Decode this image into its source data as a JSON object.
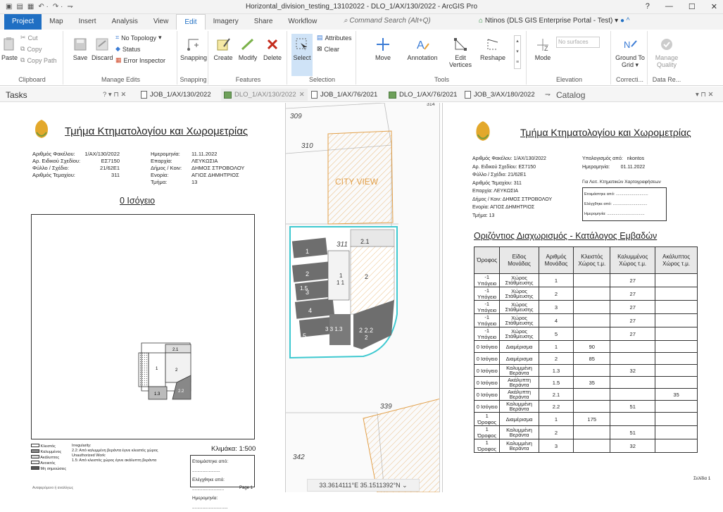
{
  "window": {
    "title": "Horizontal_division_testing_13102022 - DLO_1/AX/130/2022 - ArcGIS Pro",
    "help": "?",
    "minimize": "—",
    "maximize": "☐",
    "close": "✕"
  },
  "ribbon_tabs": [
    "Project",
    "Map",
    "Insert",
    "Analysis",
    "View",
    "Edit",
    "Imagery",
    "Share",
    "Workflow"
  ],
  "command_search_placeholder": "Command Search (Alt+Q)",
  "portal": "Ntinos (DLS GIS Enterprise Portal - Test) ▾",
  "ribbon": {
    "clipboard": {
      "label": "Clipboard",
      "paste": "Paste",
      "cut": "Cut",
      "copy": "Copy",
      "copy_path": "Copy Path"
    },
    "manage_edits": {
      "label": "Manage Edits",
      "save": "Save",
      "discard": "Discard",
      "no_topology": "No Topology",
      "status": "Status",
      "error_inspector": "Error Inspector"
    },
    "snapping": {
      "label": "Snapping",
      "snapping": "Snapping"
    },
    "features": {
      "label": "Features",
      "create": "Create",
      "modify": "Modify",
      "delete": "Delete"
    },
    "selection": {
      "label": "Selection",
      "select": "Select",
      "attributes": "Attributes",
      "clear": "Clear"
    },
    "tools": {
      "label": "Tools",
      "move": "Move",
      "annotation": "Annotation",
      "edit_vertices": "Edit Vertices",
      "reshape": "Reshape"
    },
    "elevation": {
      "label": "Elevation",
      "mode": "Mode",
      "no_surfaces": "No surfaces"
    },
    "correction": {
      "label": "Correcti...",
      "ground_to_grid": "Ground To Grid ▾"
    },
    "data_review": {
      "label": "Data Re...",
      "manage_quality": "Manage Quality"
    }
  },
  "panes": {
    "tasks_title": "Tasks",
    "tasks_controls": "? ▾ ⊓ ✕",
    "catalog_title": "Catalog",
    "catalog_controls": "▾ ⊓ ✕",
    "doc_tabs": [
      {
        "label": "JOB_1/AX/130/2022",
        "type": "layout",
        "active": false
      },
      {
        "label": "DLO_1/AX/130/2022",
        "type": "map",
        "active": true
      },
      {
        "label": "JOB_1/AX/76/2021",
        "type": "layout",
        "active": false
      },
      {
        "label": "DLO_1/AX/76/2021",
        "type": "map",
        "active": false
      },
      {
        "label": "JOB_3/AX/180/2022",
        "type": "layout",
        "active": false
      }
    ],
    "overflow": "⇁"
  },
  "left_sheet": {
    "title": "Τμήμα Κτηματολογίου και Χωρομετρίας",
    "fields_left": [
      [
        "Αριθμός Φακέλου:",
        "1/AX/130/2022"
      ],
      [
        "Αρ. Ειδικού Σχεδίου:",
        "ΕΣ7150"
      ],
      [
        "Φύλλο / Σχέδιο:",
        "21/62E1"
      ],
      [
        "Αριθμός Τεμαχίου:",
        "311"
      ]
    ],
    "fields_right": [
      [
        "Ημερομηνία:",
        "11.11.2022"
      ],
      [
        "Επαρχία:",
        "ΛΕΥΚΩΣΙΑ"
      ],
      [
        "Δήμος / Κοιν:",
        "ΔΗΜΟΣ ΣΤΡΟΒΟΛΟΥ"
      ],
      [
        "Ενορία:",
        "ΑΓΙΟΣ ΔΗΜΗΤΡΙΟΣ"
      ],
      [
        "Τμήμα:",
        "13"
      ]
    ],
    "floor_title": "0 Ισόγειο",
    "plan_labels": [
      "2.1",
      "1",
      "2",
      "1.3",
      "2.2"
    ],
    "legend": [
      "Κλειστός",
      "Καλυμμένος",
      "Ακάλυπτος",
      "Ανοικτός",
      "Μη σημειώσεις"
    ],
    "irregularity": "Irregularity:",
    "irregularity_text": "2.2: Από καλυμμένη βεράντα έγινε κλειστός χώρος",
    "unauthorized": "Unauthorized Work:",
    "unauthorized_text": "1.5: Από κλειστός χώρος έγινε ακάλυπτη βεράντα",
    "scale": "Κλιμάκα: 1:500",
    "prepared": "Ετοιμάστηκε από: ......................",
    "checked": "Ελέγχθηκε από: .........................",
    "date": "Ημερομηνία: ............................",
    "page": "Page 1",
    "footer_note": "Αναφερόμενο ή αναλόγως"
  },
  "map": {
    "parcels": [
      "309",
      "310",
      "311",
      "339",
      "342",
      "314"
    ],
    "city_view": "CITY VIEW",
    "unit_labels": [
      "1",
      "2",
      "1.5",
      "3",
      "4",
      "5",
      "1",
      "1 1",
      "2",
      "3 3 1.3",
      "2 2.2",
      "2",
      "2.1"
    ],
    "coords": "33.3614111°E 35.1511392°N"
  },
  "right_sheet": {
    "title": "Τμήμα Κτηματολογίου και Χωρομετρίας",
    "fields_left": [
      "Αριθμός Φακέλου: 1/AX/130/2022",
      "Αρ. Ειδικού Σχεδίου: ΕΣ7150",
      "Φύλλο / Σχέδιο: 21/62E1",
      "Αριθμός Τεμαχίου: 311",
      "Επαρχία: ΛΕΥΚΩΣΙΑ",
      "Δήμος / Κοιν: ΔΗΜΟΣ ΣΤΡΟΒΟΛΟΥ",
      "Ενορία: ΑΓΙΟΣ ΔΗΜΗΤΡΙΟΣ",
      "Τμήμα: 13"
    ],
    "calc_by": "Υπολογισμός από:",
    "calc_by_val": "nkontos",
    "date_label": "Ημερομηνία:",
    "date_val": "01.11.2022",
    "mapping_use": "Για Λειτ. Κτηματικών Χαρτογραφήσεων",
    "box_lines": [
      "Ετοιμάστηκε από: ..............................",
      "Ελέγχθηκε από: ................................",
      "Ημερομηνία: ..................................."
    ],
    "table_title": "Οριζόντιος Διαχωρισμός - Κατάλογος Εμβαδών",
    "headers": [
      "Όροφος",
      "Είδος Μονάδας",
      "Αριθμός Μονάδας",
      "Κλειστός Χώρος τ.μ.",
      "Καλυμμένος Χώρος τ.μ.",
      "Ακάλυπτος Χώρος τ.μ."
    ],
    "rows": [
      [
        "-1 Υπόγειο",
        "Χώρος Στάθμευσης",
        "1",
        "",
        "27",
        ""
      ],
      [
        "-1 Υπόγειο",
        "Χώρος Στάθμευσης",
        "2",
        "",
        "27",
        ""
      ],
      [
        "-1 Υπόγειο",
        "Χώρος Στάθμευσης",
        "3",
        "",
        "27",
        ""
      ],
      [
        "-1 Υπόγειο",
        "Χώρος Στάθμευσης",
        "4",
        "",
        "27",
        ""
      ],
      [
        "-1 Υπόγειο",
        "Χώρος Στάθμευσης",
        "5",
        "",
        "27",
        ""
      ],
      [
        "0 Ισόγειο",
        "Διαμέρισμα",
        "1",
        "90",
        "",
        ""
      ],
      [
        "0 Ισόγειο",
        "Διαμέρισμα",
        "2",
        "85",
        "",
        ""
      ],
      [
        "0 Ισόγειο",
        "Καλυμμένη Βεράντα",
        "1.3",
        "",
        "32",
        ""
      ],
      [
        "0 Ισόγειο",
        "Ακάλυπτη Βεράντα",
        "1.5",
        "35",
        "",
        ""
      ],
      [
        "0 Ισόγειο",
        "Ακάλυπτη Βεράντα",
        "2.1",
        "",
        "",
        "35"
      ],
      [
        "0 Ισόγειο",
        "Καλυμμένη Βεράντα",
        "2.2",
        "",
        "51",
        ""
      ],
      [
        "1 Όροφος",
        "Διαμέρισμα",
        "1",
        "175",
        "",
        ""
      ],
      [
        "1 Όροφος",
        "Καλυμμένη Βεράντα",
        "2",
        "",
        "51",
        ""
      ],
      [
        "1 Όροφος",
        "Καλυμμένη Βεράντα",
        "3",
        "",
        "32",
        ""
      ]
    ],
    "page": "Σελίδα 1"
  },
  "colors": {
    "accent": "#1f6fc3",
    "selection": "#3ec9d0",
    "building": "#6e6e6e",
    "parcel_line": "#e2a04a"
  }
}
